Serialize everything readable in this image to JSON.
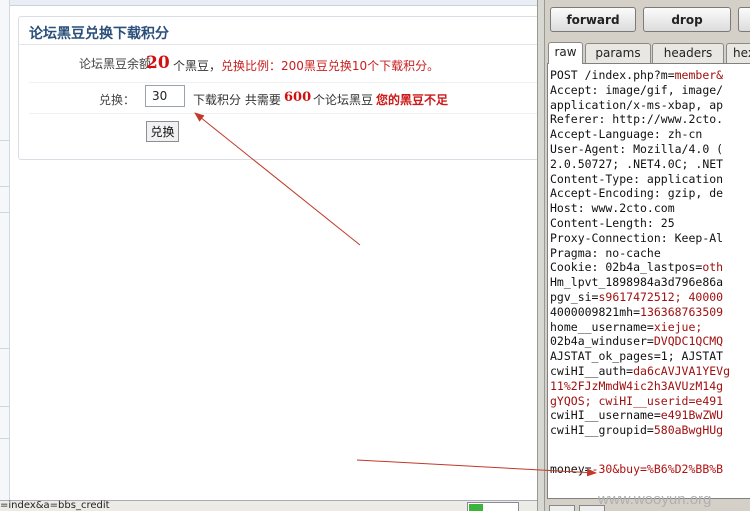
{
  "browser": {
    "card_title": "论坛黑豆兑换下载积分",
    "balance_label": "论坛黑豆余额：",
    "balance_value": "20",
    "balance_unit": "个黑豆，",
    "ratio_text": "兑换比例：200黑豆兑换10个下载积分。",
    "exchange_label": "兑换：",
    "amount_value": "30",
    "unit_text": "下载积分 共需要",
    "need_value": "600",
    "need_unit": "个论坛黑豆",
    "warning": "您的黑豆不足",
    "submit_label": "兑换",
    "status_url": "=index&a=bbs_credit",
    "progress_fraction": 0.3
  },
  "proxy": {
    "buttons": {
      "forward": "forward",
      "drop": "drop"
    },
    "tabs": [
      "raw",
      "params",
      "headers",
      "hex"
    ],
    "active_tab": "raw",
    "request_lines": [
      [
        "POST /index.php?m=",
        "member&"
      ],
      [
        "Accept: image/gif, image/",
        ""
      ],
      [
        "application/x-ms-xbap, ap",
        ""
      ],
      [
        "Referer: http://www.2cto.",
        ""
      ],
      [
        "Accept-Language: zh-cn",
        ""
      ],
      [
        "User-Agent: Mozilla/4.0 (",
        ""
      ],
      [
        "2.0.50727; .NET4.0C; .NET",
        ""
      ],
      [
        "Content-Type: application",
        ""
      ],
      [
        "Accept-Encoding: gzip, de",
        ""
      ],
      [
        "Host: www.2cto.com",
        ""
      ],
      [
        "Content-Length: 25",
        ""
      ],
      [
        "Proxy-Connection: Keep-Al",
        ""
      ],
      [
        "Pragma: no-cache",
        ""
      ],
      [
        "Cookie: 02b4a_lastpos=",
        "oth"
      ],
      [
        "Hm_lpvt_1898984a3d796e86a",
        ""
      ],
      [
        "pgv_si=",
        "s9617472512; 40000"
      ],
      [
        "4000009821mh=",
        "136368763509"
      ],
      [
        "home__username=",
        "xiejue;"
      ],
      [
        "02b4a_winduser=",
        "DVQDC1QCMQ"
      ],
      [
        "AJSTAT_ok_pages=1; AJSTAT",
        ""
      ],
      [
        "cwiHI__auth=",
        "da6cAVJVA1YEVg"
      ],
      [
        "",
        "11%2FJzMmdW4ic2h3AVUzM14g"
      ],
      [
        "",
        "gYQOS; cwiHI__userid=e491"
      ],
      [
        "cwiHI__username=",
        "e491BwZWU"
      ],
      [
        "cwiHI__groupid=",
        "580aBwgHUg"
      ]
    ],
    "body_key": "money=",
    "body_value": "-30&buy=%B6%D2%BB%B"
  },
  "watermark": "www.wooyun.org",
  "colors": {
    "title": "#2b4f7a",
    "alert": "#d01111",
    "cookie_value": "#a01010",
    "panel_bg": "#d4d0c8"
  }
}
